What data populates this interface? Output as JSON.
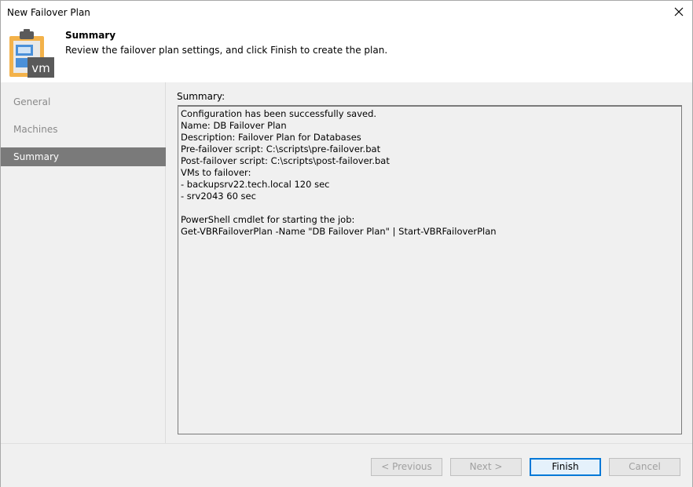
{
  "window": {
    "title": "New Failover Plan"
  },
  "header": {
    "title": "Summary",
    "subtitle": "Review the failover plan settings, and click Finish to create the plan.",
    "icon": "clipboard-vm-icon",
    "icon_badge": "vm"
  },
  "nav": {
    "items": [
      {
        "label": "General",
        "active": false
      },
      {
        "label": "Machines",
        "active": false
      },
      {
        "label": "Summary",
        "active": true
      }
    ]
  },
  "content": {
    "label": "Summary:",
    "summary_text": "Configuration has been successfully saved.\nName: DB Failover Plan\nDescription: Failover Plan for Databases\nPre-failover script: C:\\scripts\\pre-failover.bat\nPost-failover script: C:\\scripts\\post-failover.bat\nVMs to failover:\n- backupsrv22.tech.local 120 sec\n- srv2043 60 sec\n\nPowerShell cmdlet for starting the job:\nGet-VBRFailoverPlan -Name \"DB Failover Plan\" | Start-VBRFailoverPlan"
  },
  "footer": {
    "previous_label": "< Previous",
    "next_label": "Next >",
    "finish_label": "Finish",
    "cancel_label": "Cancel"
  },
  "colors": {
    "accent": "#0078d7",
    "nav_active_bg": "#7a7a7a",
    "panel_bg": "#f0f0f0",
    "icon_orange": "#f3b24a"
  }
}
